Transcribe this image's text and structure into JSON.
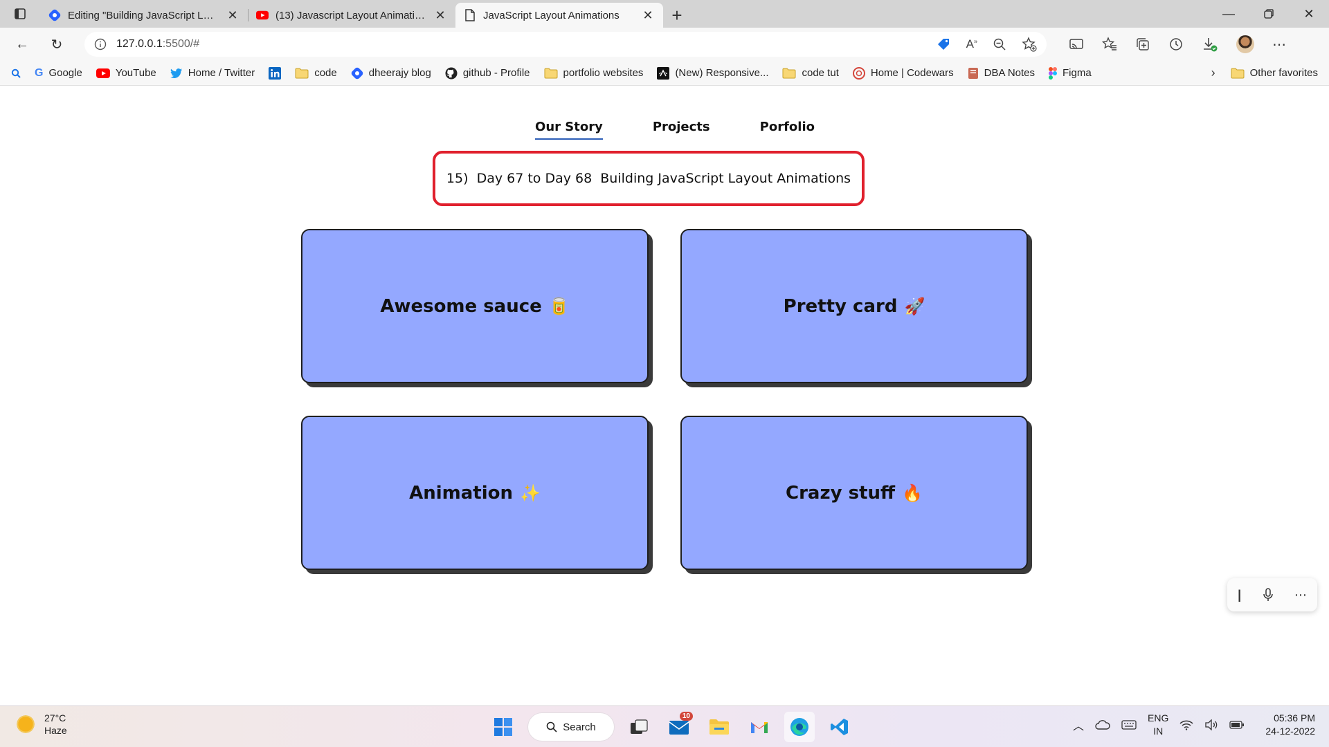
{
  "browser": {
    "tabs": [
      {
        "title": "Editing \"Building JavaScript Layout Animations\"",
        "icon": "hashnode-icon"
      },
      {
        "title": "(13) Javascript Layout Animations",
        "icon": "youtube-icon"
      },
      {
        "title": "JavaScript Layout Animations",
        "icon": "page-icon",
        "active": true
      }
    ],
    "address": {
      "host": "127.0.0.1",
      "rest": ":5500/#"
    },
    "bookmarks": [
      {
        "label": "Google",
        "icon": "google-icon"
      },
      {
        "label": "YouTube",
        "icon": "youtube-icon"
      },
      {
        "label": "Home / Twitter",
        "icon": "twitter-icon"
      },
      {
        "label": "",
        "icon": "linkedin-icon"
      },
      {
        "label": "code",
        "icon": "folder-icon"
      },
      {
        "label": "dheerajy blog",
        "icon": "hashnode-icon"
      },
      {
        "label": "github - Profile",
        "icon": "github-icon"
      },
      {
        "label": "portfolio websites",
        "icon": "folder-icon"
      },
      {
        "label": "(New) Responsive...",
        "icon": "codepen-icon"
      },
      {
        "label": "code tut",
        "icon": "folder-icon"
      },
      {
        "label": "Home | Codewars",
        "icon": "codewars-icon"
      },
      {
        "label": "DBA Notes",
        "icon": "notes-icon"
      },
      {
        "label": "Figma",
        "icon": "figma-icon"
      }
    ],
    "other_favorites": "Other favorites"
  },
  "page": {
    "nav": [
      "Our Story",
      "Projects",
      "Porfolio"
    ],
    "headline": "15)  Day 67 to Day 68  Building JavaScript Layout Animations",
    "cards": [
      {
        "label": "Awesome sauce",
        "emoji": "🥫"
      },
      {
        "label": "Pretty card",
        "emoji": "🚀"
      },
      {
        "label": "Animation",
        "emoji": "✨"
      },
      {
        "label": "Crazy stuff",
        "emoji": "🔥"
      }
    ]
  },
  "taskbar": {
    "weather": {
      "temp": "27°C",
      "condition": "Haze"
    },
    "search_label": "Search",
    "mail_badge": "10",
    "lang": {
      "line1": "ENG",
      "line2": "IN"
    },
    "clock": {
      "time": "05:36 PM",
      "date": "24-12-2022"
    }
  },
  "colors": {
    "card_bg": "#94a8ff",
    "headline_border": "#e0202d",
    "nav_underline": "#2e5fb8"
  }
}
